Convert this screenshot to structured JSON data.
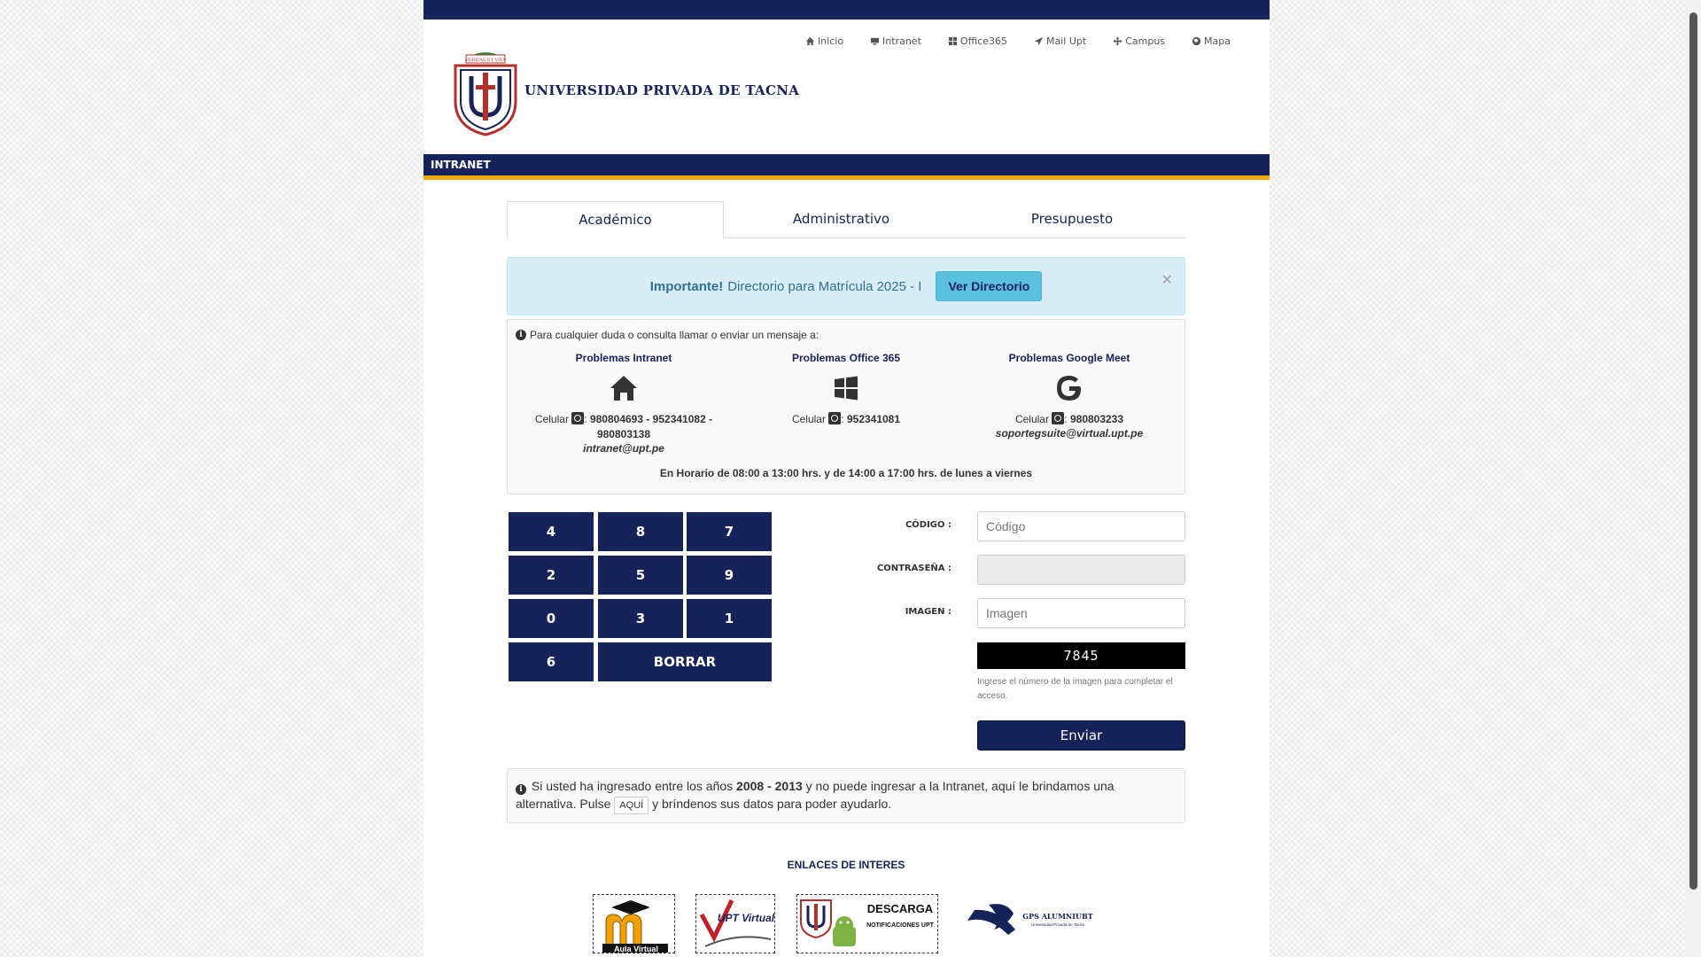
{
  "topnav": [
    {
      "label": "Inicio",
      "icon": "home-icon"
    },
    {
      "label": "Intranet",
      "icon": "monitor-icon"
    },
    {
      "label": "Office365",
      "icon": "grid-icon"
    },
    {
      "label": "Mail Upt",
      "icon": "send-icon"
    },
    {
      "label": "Campus",
      "icon": "arrows-icon"
    },
    {
      "label": "Mapa",
      "icon": "globe-icon"
    }
  ],
  "logo": {
    "name": "UNIVERSIDAD PRIVADA DE TACNA",
    "motto": "VERITAS ET VITA"
  },
  "section_title": "INTRANET",
  "tabs": [
    {
      "label": "Académico",
      "active": true
    },
    {
      "label": "Administrativo",
      "active": false
    },
    {
      "label": "Presupuesto",
      "active": false
    }
  ],
  "alert": {
    "strong": "Importante!",
    "text": "Directorio para Matrícula 2025 - I",
    "button": "Ver Directorio",
    "close": "×"
  },
  "help": {
    "intro": "Para cualquier duda o consulta llamar o enviar un mensaje a:",
    "columns": [
      {
        "title": "Problemas Intranet",
        "icon": "home-icon",
        "prefix": "Celular",
        "phones": "980804693 - 952341082 - 980803138",
        "email": "intranet@upt.pe"
      },
      {
        "title": "Problemas Office 365",
        "icon": "windows-icon",
        "prefix": "Celular",
        "phones": "952341081",
        "email": ""
      },
      {
        "title": "Problemas Google Meet",
        "icon": "google-icon",
        "prefix": "Celular",
        "phones": "980803233",
        "email": "soportegsuite@virtual.upt.pe"
      }
    ],
    "schedule": "En Horario de 08:00 a 13:00 hrs. y de 14:00 a 17:00 hrs. de lunes a viernes"
  },
  "keypad": [
    "4",
    "8",
    "7",
    "2",
    "5",
    "9",
    "0",
    "3",
    "1",
    "6",
    "BORRAR"
  ],
  "form": {
    "code_label": "CÓDIGO :",
    "code_placeholder": "Código",
    "password_label": "CONTRASEÑA :",
    "image_label": "IMAGEN :",
    "image_placeholder": "Imagen",
    "captcha": "7845",
    "captcha_help": "Ingrese el número de la imagen para completar el acceso.",
    "submit": "Enviar"
  },
  "alt": {
    "p1": "Si usted ha ingresado entre los años",
    "years": "2008 - 2013",
    "p2": "y no puede ingresar a la Intranet, aquí le brindamos una alternativa. Pulse",
    "button": "AQUÍ",
    "p3": "y bríndenos sus datos para poder ayudarlo."
  },
  "links": {
    "title": "ENLACES DE INTERES",
    "items": [
      {
        "label": "Aula Virtual"
      },
      {
        "label": "UPT Virtual"
      },
      {
        "label": "DESCARGA",
        "sub": "NOTIFICACIONES UPT"
      },
      {
        "label": "GPS ALUMNIUBT",
        "sub": "Universidad Privada de Tacna"
      }
    ]
  },
  "colors": {
    "navy": "#15235a",
    "gold": "#f2a900",
    "info_bg": "#d9edf7",
    "info_btn": "#5bc0de"
  }
}
